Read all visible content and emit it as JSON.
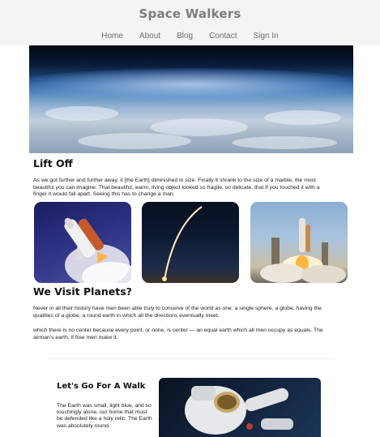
{
  "header": {
    "title": "Space Walkers",
    "nav": [
      "Home",
      "About",
      "Blog",
      "Contact",
      "Sign In"
    ]
  },
  "lift_off": {
    "title": "Lift Off",
    "text": "As we got further and further away, it [the Earth] diminished in size. Finally it shrank to the size of a marble, the most beautiful you can imagine. That beautiful, warm, living object looked so fragile, so delicate, that if you touched it with a finger it would fall apart. Seeing this has to change a man."
  },
  "planets": {
    "title": "We Visit Planets?",
    "text1": "Never in all their history have men been able truly to conceive of the world as one: a single sphere, a globe, having the qualities of a globe, a round earth in which all the directions eventually meet.",
    "text2": "which there is no center because every point, or none, is center — an equal earth which all men occupy as equals. The airman's earth, if free men make it."
  },
  "walk": {
    "title": "Let's Go For A Walk",
    "text": "The Earth was small, light blue, and so touchingly alone, our home that must be defended like a holy relic. The Earth was absolutely round."
  },
  "colors": {
    "header_bg": "#f4f4f4",
    "title_color": "#7d7d7d",
    "nav_color": "#6e6e6e",
    "text_color": "#111111"
  }
}
